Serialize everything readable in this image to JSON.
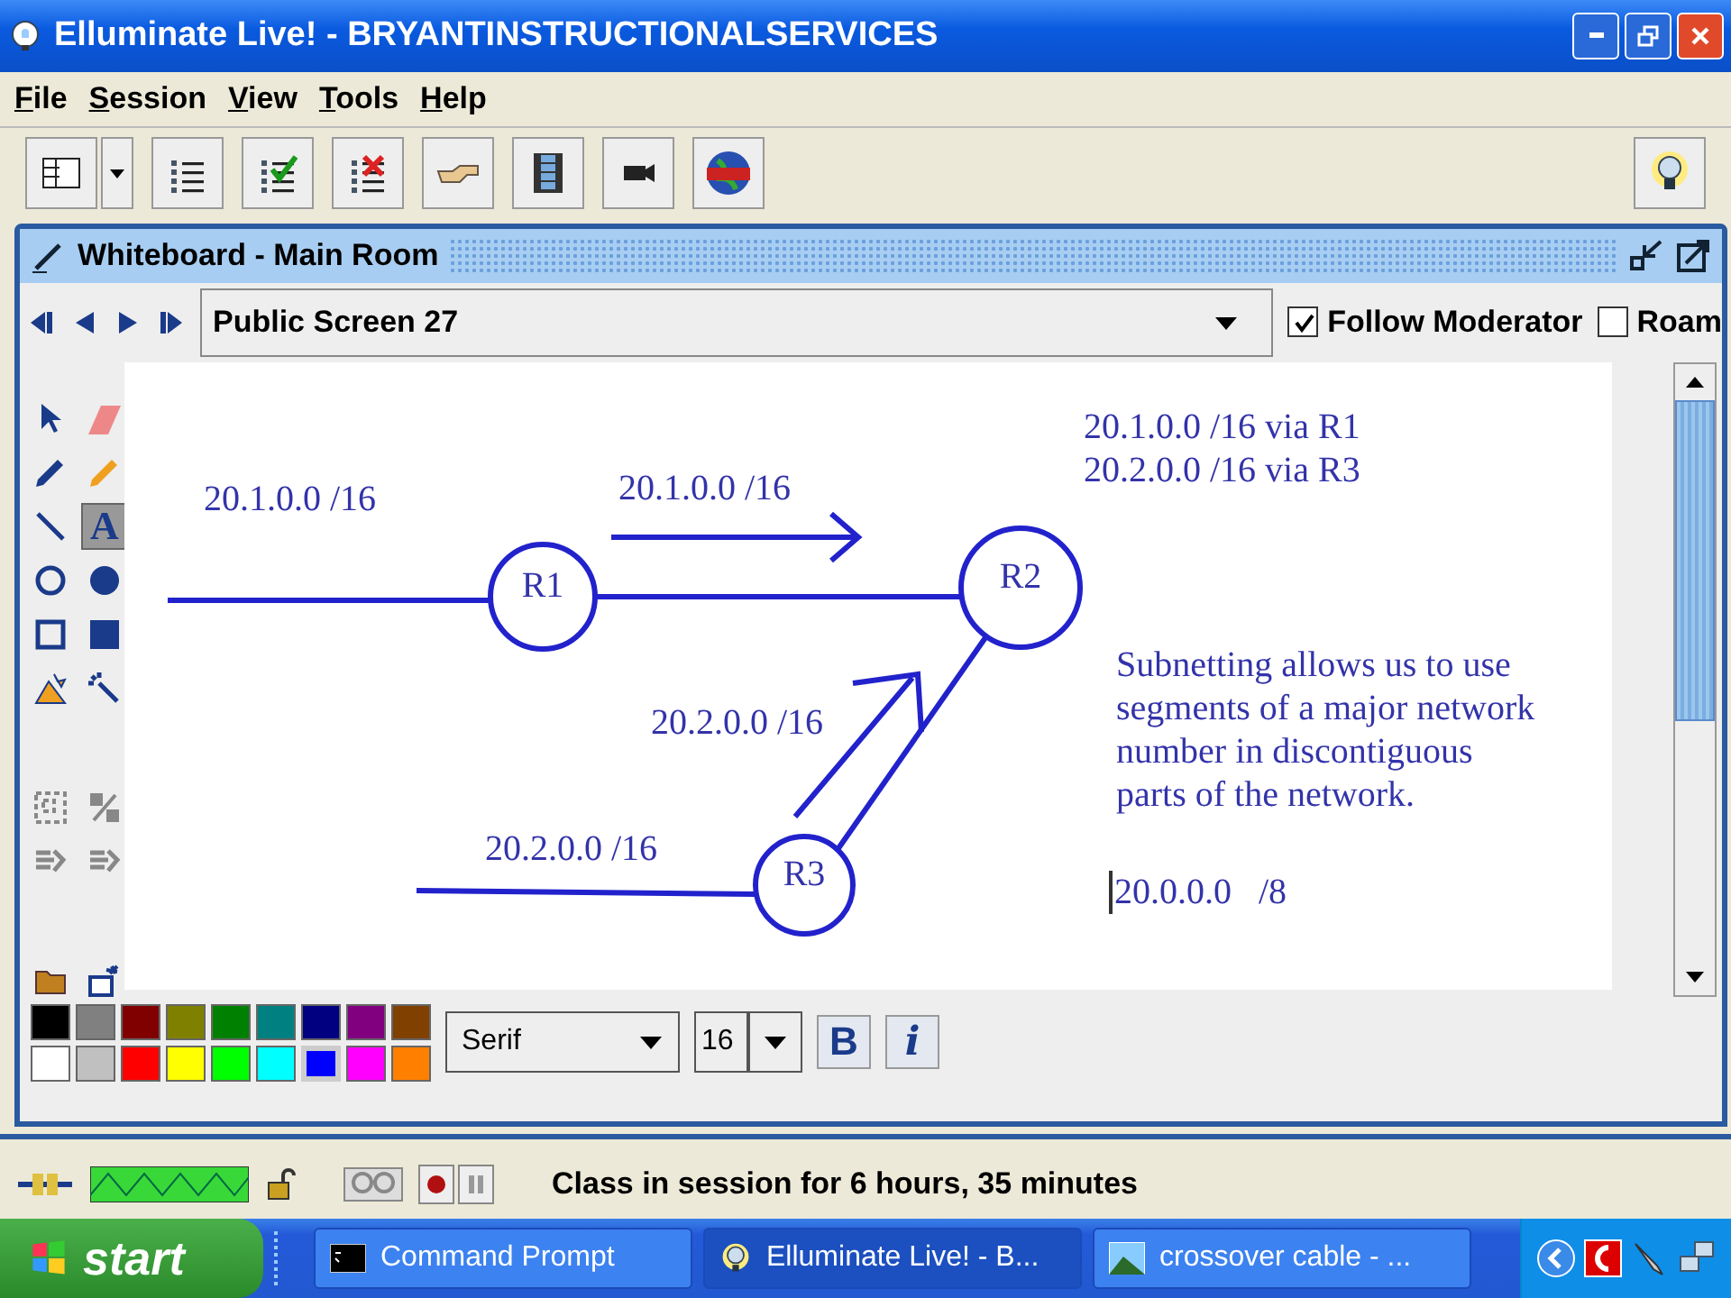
{
  "window": {
    "title": "Elluminate Live! - BRYANTINSTRUCTIONALSERVICES"
  },
  "menu": [
    "File",
    "Session",
    "View",
    "Tools",
    "Help"
  ],
  "toolbar": [
    {
      "kind": "layout"
    },
    {
      "kind": "list"
    },
    {
      "kind": "list-check"
    },
    {
      "kind": "list-x"
    },
    {
      "kind": "hand"
    },
    {
      "kind": "film"
    },
    {
      "kind": "camera"
    },
    {
      "kind": "globe"
    }
  ],
  "whiteboard": {
    "title": "Whiteboard - Main Room",
    "screen": "Public Screen 27",
    "options": [
      {
        "label": "Follow Moderator",
        "checked": true
      },
      {
        "label": "Roam",
        "checked": false
      }
    ],
    "tool_groups": [
      [
        {
          "kind": "pointer",
          "selected": false
        },
        {
          "kind": "eraser",
          "selected": false
        },
        {
          "kind": "pen",
          "selected": false
        },
        {
          "kind": "highlighter",
          "selected": false
        },
        {
          "kind": "line",
          "selected": false
        },
        {
          "kind": "text",
          "label": "A",
          "selected": true
        },
        {
          "kind": "circle",
          "selected": false
        },
        {
          "kind": "disc",
          "selected": false
        },
        {
          "kind": "square",
          "selected": false
        },
        {
          "kind": "block",
          "selected": false
        },
        {
          "kind": "image",
          "selected": false
        },
        {
          "kind": "wand",
          "selected": false
        }
      ],
      [
        {
          "kind": "group",
          "selected": false
        },
        {
          "kind": "split",
          "selected": false
        },
        {
          "kind": "back",
          "selected": false
        },
        {
          "kind": "front",
          "selected": false
        }
      ],
      [
        {
          "kind": "open",
          "selected": false
        },
        {
          "kind": "new",
          "selected": false
        }
      ]
    ],
    "canvas": {
      "nodes": [
        "R1",
        "R2",
        "R3"
      ],
      "link_labels": [
        "20.1.0.0 /16",
        "20.1.0.0 /16",
        "20.2.0.0 /16",
        "20.2.0.0 /16"
      ],
      "routes": [
        "20.1.0.0 /16 via R1",
        "20.2.0.0 /16 via R3"
      ],
      "note": "Subnetting allows us to use segments of a major network number in discontiguous parts of the network.",
      "typing": "20.0.0.0   /8"
    },
    "palette": [
      {
        "color": "#000000",
        "selected": false
      },
      {
        "color": "#808080",
        "selected": false
      },
      {
        "color": "#800000",
        "selected": false
      },
      {
        "color": "#808000",
        "selected": false
      },
      {
        "color": "#008000",
        "selected": false
      },
      {
        "color": "#008080",
        "selected": false
      },
      {
        "color": "#000080",
        "selected": false
      },
      {
        "color": "#800080",
        "selected": false
      },
      {
        "color": "#804000",
        "selected": false
      },
      {
        "color": "#ffffff",
        "selected": false
      },
      {
        "color": "#c0c0c0",
        "selected": false
      },
      {
        "color": "#ff0000",
        "selected": false
      },
      {
        "color": "#ffff00",
        "selected": false
      },
      {
        "color": "#00ff00",
        "selected": false
      },
      {
        "color": "#00ffff",
        "selected": false
      },
      {
        "color": "#0000ff",
        "selected": true
      },
      {
        "color": "#ff00ff",
        "selected": false
      },
      {
        "color": "#ff8000",
        "selected": false
      }
    ],
    "font": "Serif",
    "size": "16",
    "bold": "B",
    "italic": "i"
  },
  "status": "Class in session for 6 hours, 35 minutes",
  "taskbar": {
    "start": "start",
    "tasks": [
      {
        "label": "Command Prompt",
        "kind": "console",
        "selected": false
      },
      {
        "label": "Elluminate Live! - B...",
        "kind": "bulb",
        "selected": true
      },
      {
        "label": "crossover cable - ...",
        "kind": "picture",
        "selected": false
      }
    ]
  }
}
